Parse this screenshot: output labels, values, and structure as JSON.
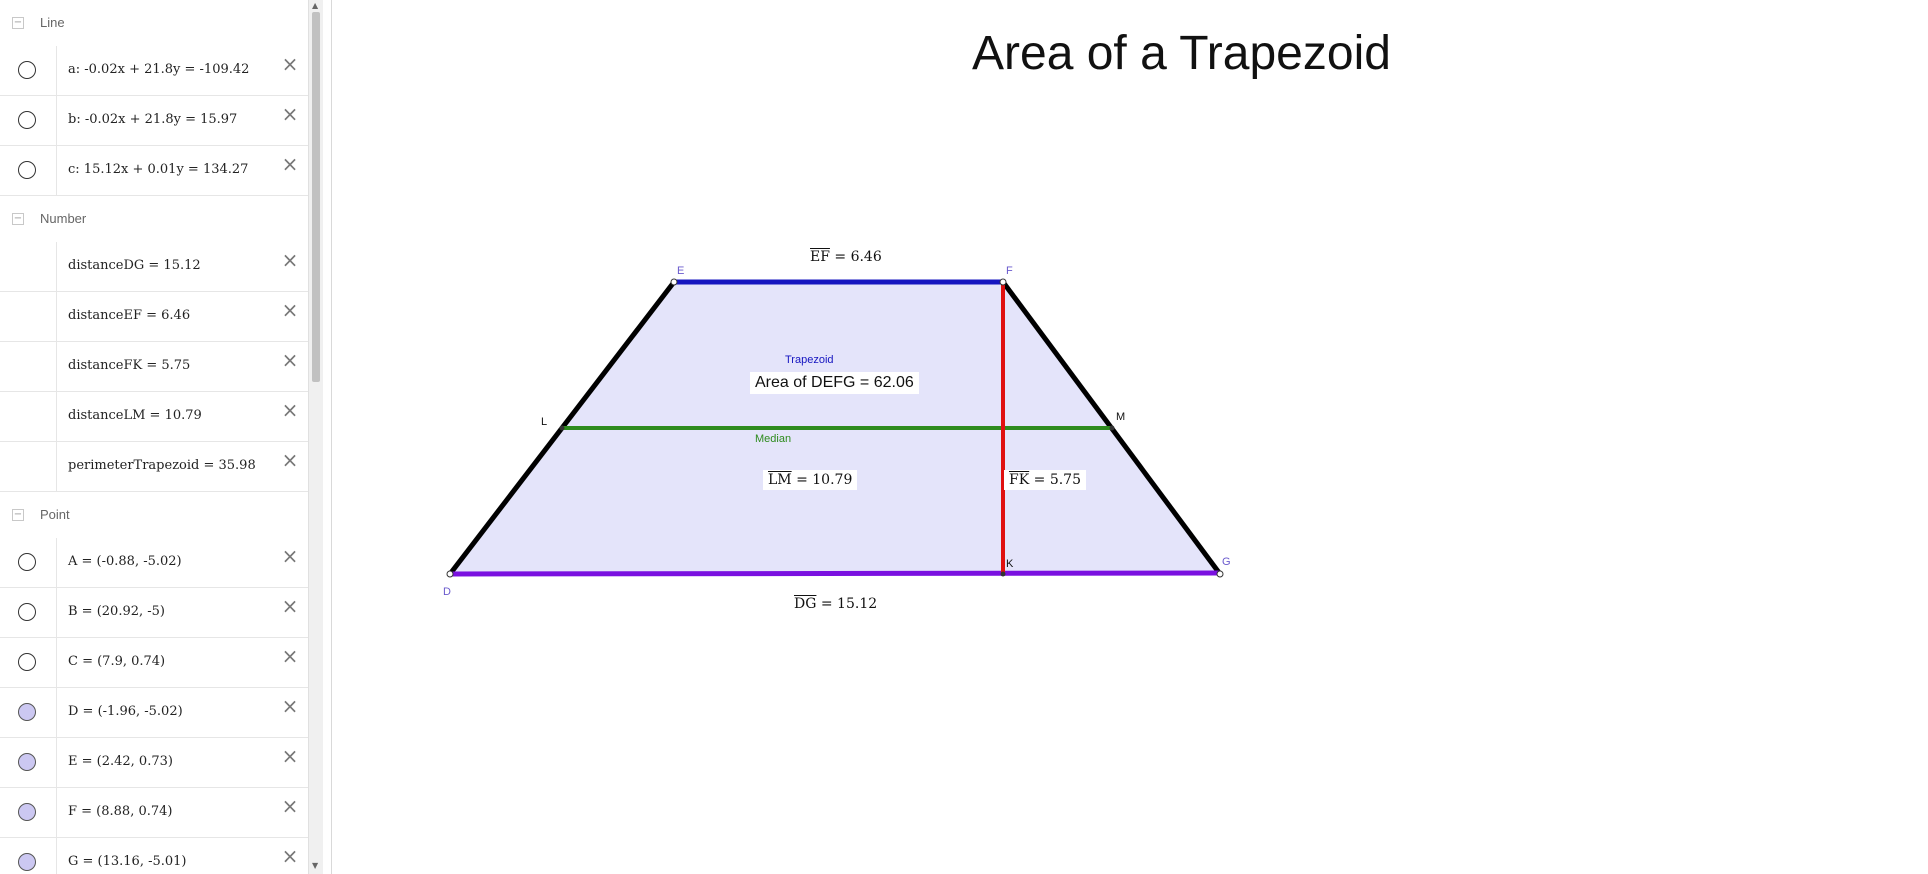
{
  "algebra": {
    "groups": [
      {
        "name": "Line"
      },
      {
        "name": "Number"
      },
      {
        "name": "Point"
      }
    ],
    "lines": [
      {
        "text": "a: -0.02x + 21.8y = -109.42"
      },
      {
        "text": "b: -0.02x + 21.8y = 15.97"
      },
      {
        "text": "c: 15.12x + 0.01y = 134.27"
      }
    ],
    "numbers": [
      {
        "text": "distanceDG = 15.12"
      },
      {
        "text": "distanceEF = 6.46"
      },
      {
        "text": "distanceFK = 5.75"
      },
      {
        "text": "distanceLM = 10.79"
      },
      {
        "text": "perimeterTrapezoid = 35.98"
      }
    ],
    "points": [
      {
        "text": "A = (-0.88, -5.02)",
        "visible": false
      },
      {
        "text": "B = (20.92, -5)",
        "visible": false
      },
      {
        "text": "C = (7.9, 0.74)",
        "visible": false
      },
      {
        "text": "D = (-1.96, -5.02)",
        "visible": true
      },
      {
        "text": "E = (2.42, 0.73)",
        "visible": true
      },
      {
        "text": "F = (8.88, 0.74)",
        "visible": true
      },
      {
        "text": "G = (13.16, -5.01)",
        "visible": true
      }
    ],
    "collapse_glyph": "−",
    "delete_glyph": "×",
    "scroll_up": "▲",
    "scroll_down": "▼"
  },
  "graphics": {
    "title": "Area of a Trapezoid",
    "ef_seg": "EF",
    "ef_value": "= 6.46",
    "dg_seg": "DG",
    "dg_value": "= 15.12",
    "lm_seg": "LM",
    "lm_value": "= 10.79",
    "fk_seg": "FK",
    "fk_value": "= 5.75",
    "trapezoid_label": "Trapezoid",
    "area_text": "Area of  DEFG = 62.06",
    "median_label": "Median",
    "points": {
      "D": "D",
      "E": "E",
      "F": "F",
      "G": "G",
      "K": "K",
      "L": "L",
      "M": "M"
    }
  },
  "colors": {
    "fill": "#e4e4fa",
    "top_edge": "#1515c0",
    "bottom_edge": "#7a10e0",
    "median": "#2e8b1e",
    "height": "#e01010",
    "point_label": "#6a5acd",
    "trapezoid_label": "#1515c0"
  }
}
